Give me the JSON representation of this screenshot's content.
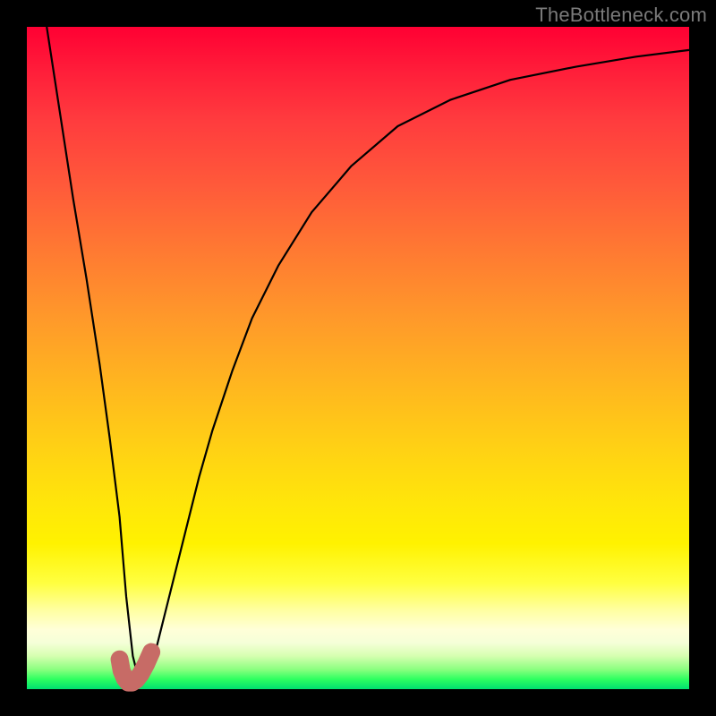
{
  "attribution": "TheBottleneck.com",
  "chart_data": {
    "type": "line",
    "title": "",
    "xlabel": "",
    "ylabel": "",
    "xlim": [
      0,
      100
    ],
    "ylim": [
      0,
      100
    ],
    "series": [
      {
        "name": "curve",
        "color": "#000000",
        "x": [
          3,
          5,
          7,
          9,
          11,
          12.5,
          14,
          15,
          16,
          17,
          18,
          19,
          20,
          22,
          24,
          26,
          28,
          31,
          34,
          38,
          43,
          49,
          56,
          64,
          73,
          83,
          92,
          100
        ],
        "y": [
          100,
          87,
          74,
          62,
          49,
          38,
          26,
          14,
          5,
          1,
          2,
          4,
          8,
          16,
          24,
          32,
          39,
          48,
          56,
          64,
          72,
          79,
          85,
          89,
          92,
          94,
          95.5,
          96.5
        ]
      },
      {
        "name": "marker-segment",
        "color": "#c76b66",
        "x": [
          14.0,
          14.3,
          14.8,
          15.3,
          15.9,
          16.5,
          17.2,
          18.0,
          18.8
        ],
        "y": [
          4.5,
          2.8,
          1.6,
          1.0,
          1.0,
          1.4,
          2.3,
          3.8,
          5.6
        ]
      }
    ]
  }
}
